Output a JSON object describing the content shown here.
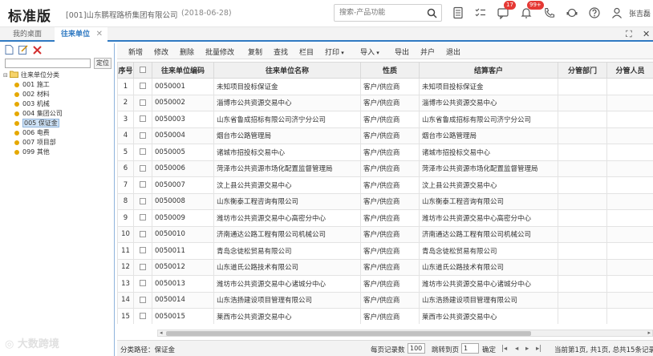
{
  "header": {
    "logo": "标准版",
    "company": "[001]山东鹏程路桥集团有限公司",
    "date": "(2018-06-28)",
    "search_placeholder": "搜索-产品功能",
    "badge_messages": "17",
    "badge_notifications": "99+",
    "username": "张吉磊"
  },
  "tabs": [
    {
      "label": "我的桌面"
    },
    {
      "label": "往来单位"
    }
  ],
  "left_panel": {
    "locate_button": "定位",
    "root_label": "往来单位分类",
    "nodes": [
      {
        "label": "001 施工"
      },
      {
        "label": "002 材料"
      },
      {
        "label": "003 机械"
      },
      {
        "label": "004 集团公司"
      },
      {
        "label": "005 保证金"
      },
      {
        "label": "006 电费"
      },
      {
        "label": "007 项目部"
      },
      {
        "label": "099 其他"
      }
    ]
  },
  "toolbar": {
    "add": "新增",
    "edit": "修改",
    "delete": "删除",
    "batch_edit": "批量修改",
    "copy": "复制",
    "find": "查找",
    "columns": "栏目",
    "print": "打印",
    "import": "导入",
    "export": "导出",
    "merge": "并户",
    "exit": "退出"
  },
  "table": {
    "columns": [
      "序号",
      "",
      "往来单位编码",
      "往来单位名称",
      "性质",
      "结算客户",
      "分管部门",
      "分管人员"
    ],
    "rows": [
      [
        "1",
        "0050001",
        "未知项目投标保证金",
        "客户/供应商",
        "未知项目投标保证金"
      ],
      [
        "2",
        "0050002",
        "淄博市公共资源交易中心",
        "客户/供应商",
        "淄博市公共资源交易中心"
      ],
      [
        "3",
        "0050003",
        "山东省鲁成招标有限公司济宁分公司",
        "客户/供应商",
        "山东省鲁成招标有限公司济宁分公司"
      ],
      [
        "4",
        "0050004",
        "烟台市公路管理局",
        "客户/供应商",
        "烟台市公路管理局"
      ],
      [
        "5",
        "0050005",
        "诸城市招投标交易中心",
        "客户/供应商",
        "诸城市招投标交易中心"
      ],
      [
        "6",
        "0050006",
        "菏泽市公共资源市场化配置监督管理局",
        "客户/供应商",
        "菏泽市公共资源市场化配置监督管理局"
      ],
      [
        "7",
        "0050007",
        "汶上县公共资源交易中心",
        "客户/供应商",
        "汶上县公共资源交易中心"
      ],
      [
        "8",
        "0050008",
        "山东衡泰工程咨询有限公司",
        "客户/供应商",
        "山东衡泰工程咨询有限公司"
      ],
      [
        "9",
        "0050009",
        "潍坊市公共资源交易中心高密分中心",
        "客户/供应商",
        "潍坊市公共资源交易中心高密分中心"
      ],
      [
        "10",
        "0050010",
        "济南通达公路工程有限公司机械公司",
        "客户/供应商",
        "济南通达公路工程有限公司机械公司"
      ],
      [
        "11",
        "0050011",
        "青岛念徒松贸易有限公司",
        "客户/供应商",
        "青岛念徒松贸易有限公司"
      ],
      [
        "12",
        "0050012",
        "山东道氏公路技术有限公司",
        "客户/供应商",
        "山东道氏公路技术有限公司"
      ],
      [
        "13",
        "0050013",
        "潍坊市公共资源交易中心诸城分中心",
        "客户/供应商",
        "潍坊市公共资源交易中心诸城分中心"
      ],
      [
        "14",
        "0050014",
        "山东浩扬建设项目管理有限公司",
        "客户/供应商",
        "山东浩扬建设项目管理有限公司"
      ],
      [
        "15",
        "0050015",
        "莱西市公共资源交易中心",
        "客户/供应商",
        "莱西市公共资源交易中心"
      ]
    ]
  },
  "statusbar": {
    "path_label": "分类路径：保证金",
    "page_size_label": "每页记录数",
    "page_size": "100",
    "jump_label": "跳转到页",
    "jump_page": "1",
    "confirm": "确定",
    "page_info": "当前第1页, 共1页, 总共15条记录"
  },
  "watermark": "大数跨境"
}
